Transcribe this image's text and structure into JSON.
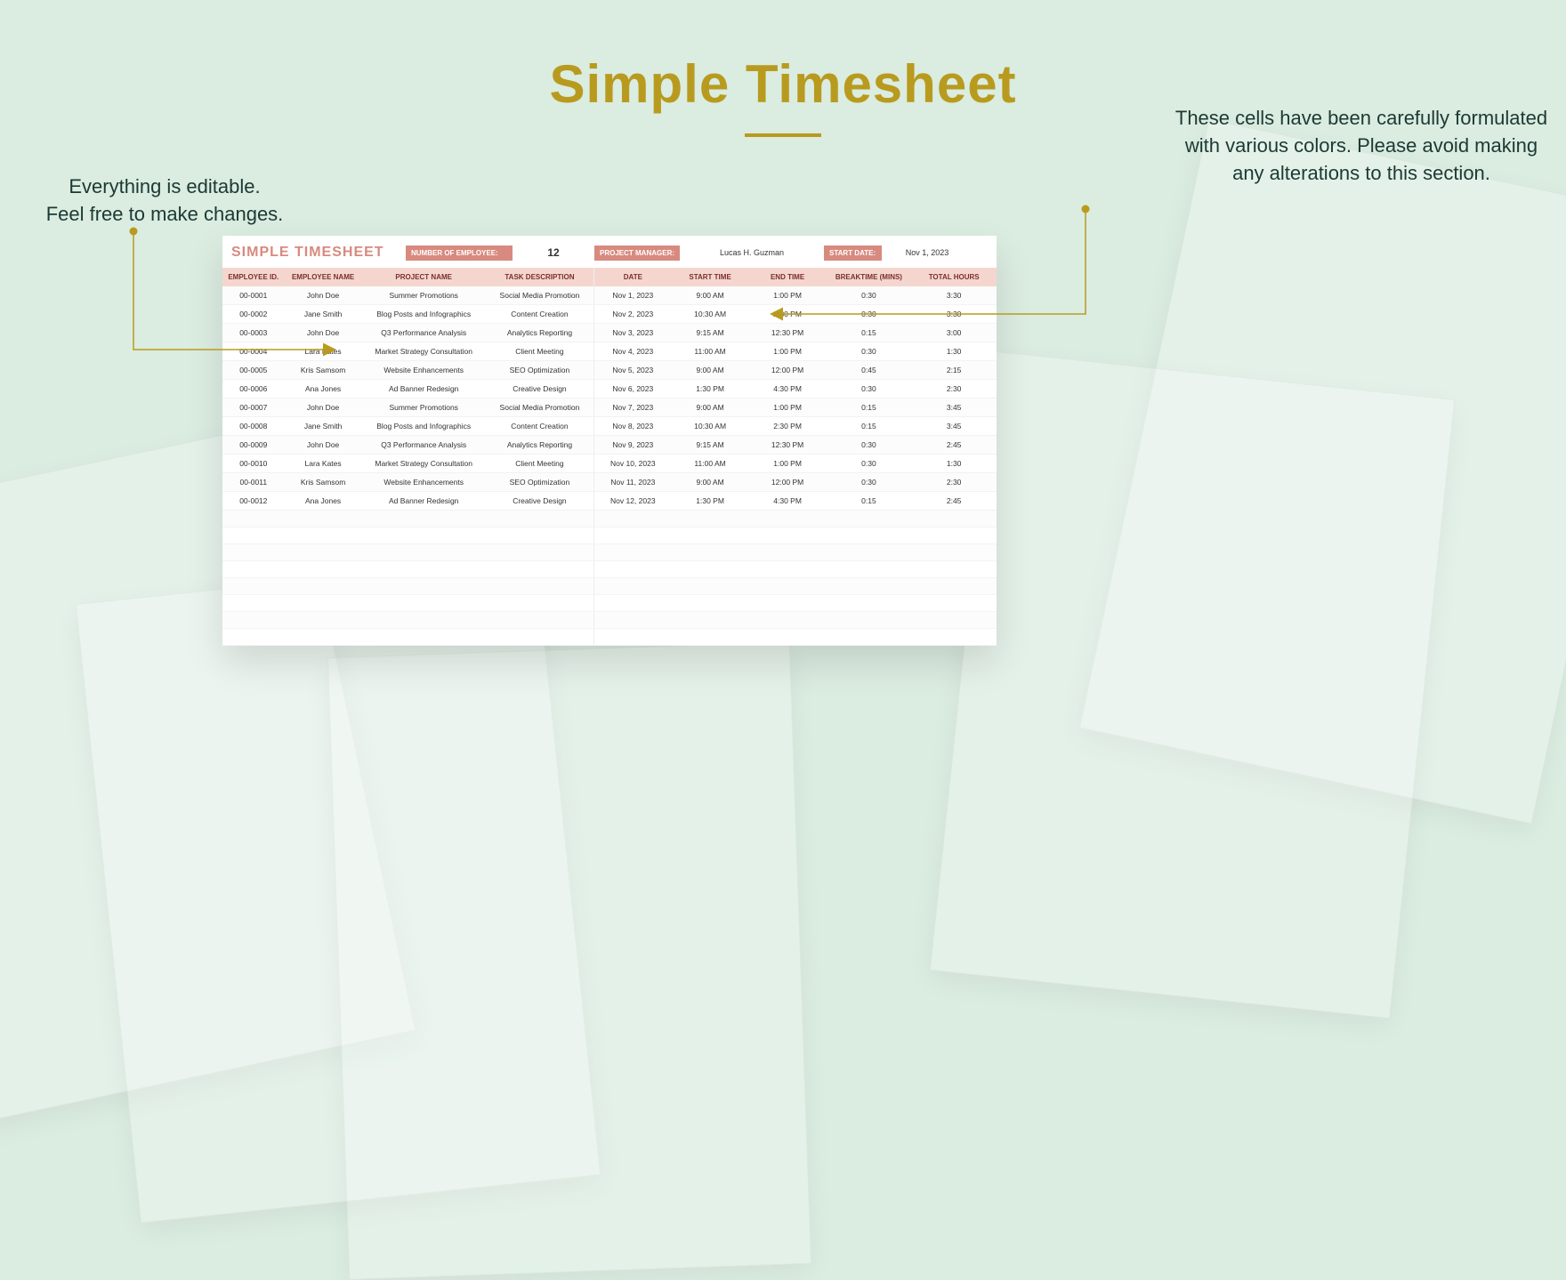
{
  "page": {
    "title": "Simple Timesheet"
  },
  "annotations": {
    "left": "Everything is editable.\nFeel free to make changes.",
    "right": "These cells have been carefully formulated with various colors. Please avoid making any alterations to this section."
  },
  "sheet": {
    "title": "SIMPLE TIMESHEET",
    "header": {
      "num_employee_label": "NUMBER OF EMPLOYEE:",
      "num_employee_value": "12",
      "pm_label": "PROJECT MANAGER:",
      "pm_value": "Lucas H. Guzman",
      "start_date_label": "START DATE:",
      "start_date_value": "Nov 1, 2023"
    },
    "columns": [
      "EMPLOYEE ID.",
      "EMPLOYEE NAME",
      "PROJECT NAME",
      "TASK DESCRIPTION",
      "DATE",
      "START TIME",
      "END TIME",
      "BREAKTIME (MINS)",
      "TOTAL HOURS"
    ],
    "rows": [
      {
        "id": "00-0001",
        "name": "John Doe",
        "project": "Summer Promotions",
        "task": "Social Media Promotion",
        "date": "Nov 1, 2023",
        "start": "9:00 AM",
        "end": "1:00 PM",
        "break": "0:30",
        "total": "3:30"
      },
      {
        "id": "00-0002",
        "name": "Jane Smith",
        "project": "Blog Posts and Infographics",
        "task": "Content Creation",
        "date": "Nov 2, 2023",
        "start": "10:30 AM",
        "end": "2:30 PM",
        "break": "0:30",
        "total": "3:30"
      },
      {
        "id": "00-0003",
        "name": "John Doe",
        "project": "Q3 Performance Analysis",
        "task": "Analytics Reporting",
        "date": "Nov 3, 2023",
        "start": "9:15 AM",
        "end": "12:30 PM",
        "break": "0:15",
        "total": "3:00"
      },
      {
        "id": "00-0004",
        "name": "Lara Kates",
        "project": "Market Strategy Consultation",
        "task": "Client Meeting",
        "date": "Nov 4, 2023",
        "start": "11:00 AM",
        "end": "1:00 PM",
        "break": "0:30",
        "total": "1:30"
      },
      {
        "id": "00-0005",
        "name": "Kris Samsom",
        "project": "Website Enhancements",
        "task": "SEO Optimization",
        "date": "Nov 5, 2023",
        "start": "9:00 AM",
        "end": "12:00 PM",
        "break": "0:45",
        "total": "2:15"
      },
      {
        "id": "00-0006",
        "name": "Ana Jones",
        "project": "Ad Banner Redesign",
        "task": "Creative Design",
        "date": "Nov 6, 2023",
        "start": "1:30 PM",
        "end": "4:30 PM",
        "break": "0:30",
        "total": "2:30"
      },
      {
        "id": "00-0007",
        "name": "John Doe",
        "project": "Summer Promotions",
        "task": "Social Media Promotion",
        "date": "Nov 7, 2023",
        "start": "9:00 AM",
        "end": "1:00 PM",
        "break": "0:15",
        "total": "3:45"
      },
      {
        "id": "00-0008",
        "name": "Jane Smith",
        "project": "Blog Posts and Infographics",
        "task": "Content Creation",
        "date": "Nov 8, 2023",
        "start": "10:30 AM",
        "end": "2:30 PM",
        "break": "0:15",
        "total": "3:45"
      },
      {
        "id": "00-0009",
        "name": "John Doe",
        "project": "Q3 Performance Analysis",
        "task": "Analytics Reporting",
        "date": "Nov 9, 2023",
        "start": "9:15 AM",
        "end": "12:30 PM",
        "break": "0:30",
        "total": "2:45"
      },
      {
        "id": "00-0010",
        "name": "Lara Kates",
        "project": "Market Strategy Consultation",
        "task": "Client Meeting",
        "date": "Nov 10, 2023",
        "start": "11:00 AM",
        "end": "1:00 PM",
        "break": "0:30",
        "total": "1:30"
      },
      {
        "id": "00-0011",
        "name": "Kris Samsom",
        "project": "Website Enhancements",
        "task": "SEO Optimization",
        "date": "Nov 11, 2023",
        "start": "9:00 AM",
        "end": "12:00 PM",
        "break": "0:30",
        "total": "2:30"
      },
      {
        "id": "00-0012",
        "name": "Ana Jones",
        "project": "Ad Banner Redesign",
        "task": "Creative Design",
        "date": "Nov 12, 2023",
        "start": "1:30 PM",
        "end": "4:30 PM",
        "break": "0:15",
        "total": "2:45"
      }
    ],
    "blank_row_count": 8
  }
}
